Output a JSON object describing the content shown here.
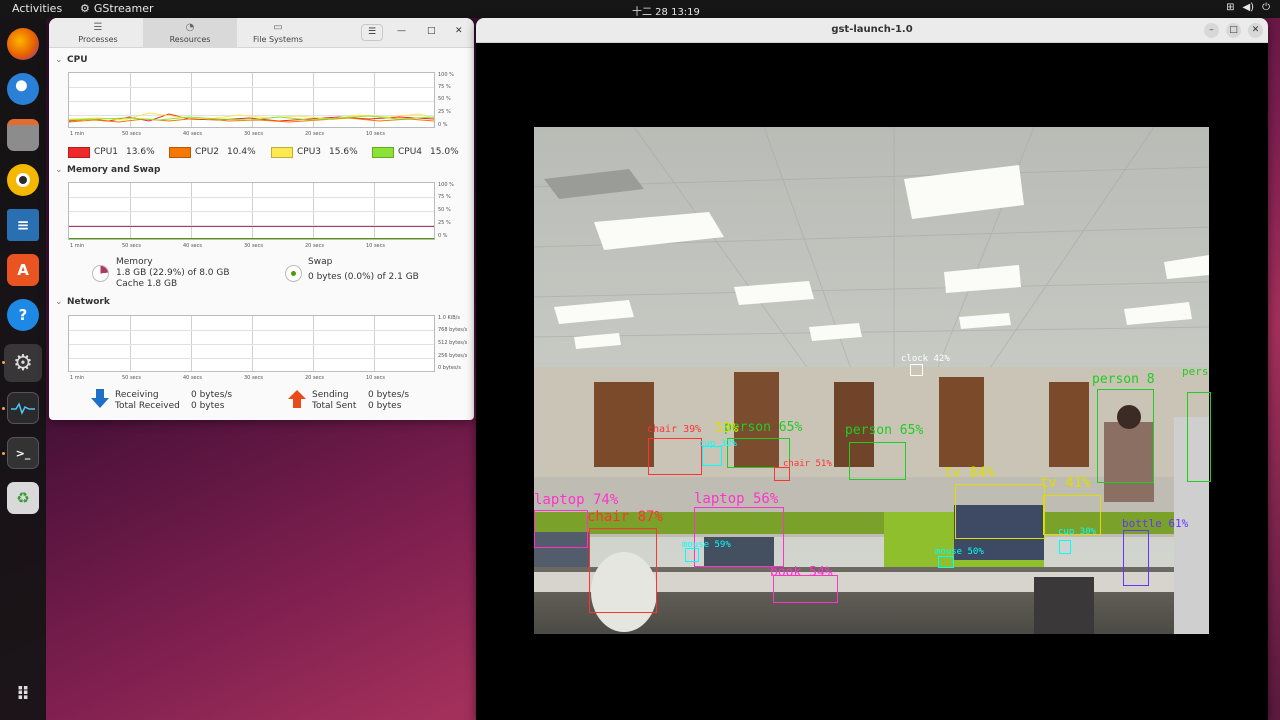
{
  "topbar": {
    "activities": "Activities",
    "app_name": "GStreamer",
    "clock": "十二 28  13:19"
  },
  "dock": {
    "items": [
      "firefox-icon",
      "thunderbird-icon",
      "files-icon",
      "rhythmbox-icon",
      "writer-icon",
      "app-center-icon",
      "help-icon",
      "settings-icon",
      "system-monitor-icon",
      "terminal-icon",
      "trash-icon",
      "show-apps-icon"
    ]
  },
  "sysmon": {
    "tabs": [
      {
        "label": "Processes",
        "icon": "list-icon"
      },
      {
        "label": "Resources",
        "icon": "gauge-icon"
      },
      {
        "label": "File Systems",
        "icon": "drive-icon"
      }
    ],
    "active_tab": "Resources",
    "x_labels": [
      "1 min",
      "50 secs",
      "40 secs",
      "30 secs",
      "20 secs",
      "10 secs"
    ],
    "cpu": {
      "title": "CPU",
      "y_labels": [
        "100 %",
        "75 %",
        "50 %",
        "25 %",
        "0 %"
      ],
      "cores": [
        {
          "name": "CPU1",
          "pct": "13.6%",
          "color": "#ef2929"
        },
        {
          "name": "CPU2",
          "pct": "10.4%",
          "color": "#f57900"
        },
        {
          "name": "CPU3",
          "pct": "15.6%",
          "color": "#fce94f"
        },
        {
          "name": "CPU4",
          "pct": "15.0%",
          "color": "#8ae234"
        }
      ]
    },
    "memory": {
      "title": "Memory and Swap",
      "y_labels": [
        "100 %",
        "75 %",
        "50 %",
        "25 %",
        "0 %"
      ],
      "mem_label": "Memory",
      "mem_value": "1.8 GB (22.9%) of 8.0 GB",
      "cache_value": "Cache 1.8 GB",
      "swap_label": "Swap",
      "swap_value": "0 bytes (0.0%) of 2.1 GB",
      "mem_color": "#ad3a5e",
      "swap_color": "#4e9a06"
    },
    "network": {
      "title": "Network",
      "y_labels": [
        "1.0 KiB/s",
        "768 bytes/s",
        "512 bytes/s",
        "256 bytes/s",
        "0 bytes/s"
      ],
      "receiving_label": "Receiving",
      "receiving_value": "0 bytes/s",
      "total_received_label": "Total Received",
      "total_received_value": "0 bytes",
      "sending_label": "Sending",
      "sending_value": "0 bytes/s",
      "total_sent_label": "Total Sent",
      "total_sent_value": "0 bytes"
    }
  },
  "gst_window": {
    "title": "gst-launch-1.0",
    "detections": [
      {
        "label": "clock 42%",
        "color": "#ffffff"
      },
      {
        "label": "person 8",
        "color": "#22cc22"
      },
      {
        "label": "pers",
        "color": "#22cc22"
      },
      {
        "label": "chair 39%",
        "color": "#ff3333"
      },
      {
        "label": "person 65%",
        "color": "#22cc22"
      },
      {
        "label": "person 65%",
        "color": "#22cc22"
      },
      {
        "label": "cup 32%",
        "color": "#00ffff"
      },
      {
        "label": "chair 51%",
        "color": "#ff3333"
      },
      {
        "label": "tv 84%",
        "color": "#dddd00"
      },
      {
        "label": "tv 41%",
        "color": "#dddd00"
      },
      {
        "label": "laptop 74%",
        "color": "#ff33cc"
      },
      {
        "label": "laptop 56%",
        "color": "#ff33cc"
      },
      {
        "label": "chair 87%",
        "color": "#ff3333"
      },
      {
        "label": "mouse 59%",
        "color": "#00ffff"
      },
      {
        "label": "mouse 50%",
        "color": "#00ffff"
      },
      {
        "label": "cup 30%",
        "color": "#00ffff"
      },
      {
        "label": "bottle 61%",
        "color": "#6633ff"
      },
      {
        "label": "book 54%",
        "color": "#ff33cc"
      },
      {
        "label": "53%",
        "color": "#dddd00"
      }
    ]
  }
}
